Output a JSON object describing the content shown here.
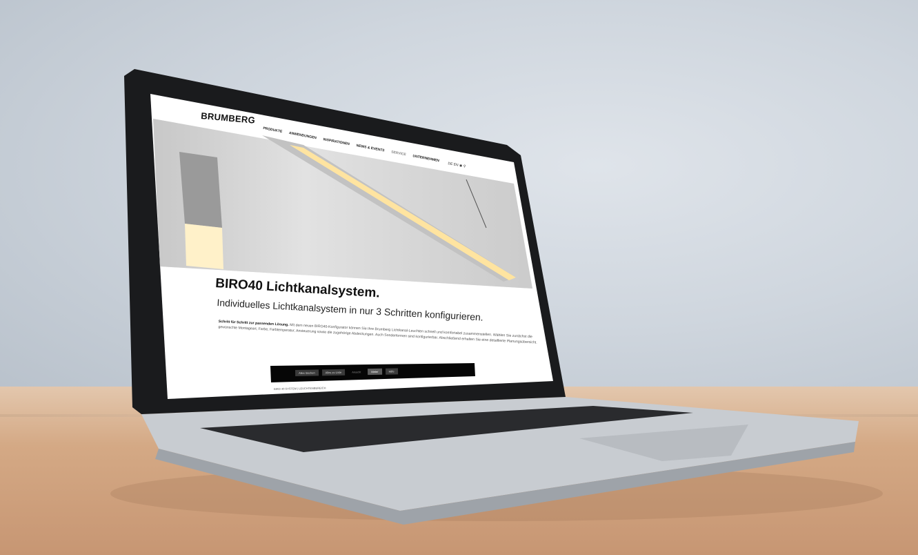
{
  "site": {
    "logo": "BRUMBERG",
    "nav": [
      {
        "label": "PRODUKTE"
      },
      {
        "label": "ANWENDUNGEN"
      },
      {
        "label": "INSPIRATIONEN"
      },
      {
        "label": "NEWS & EVENTS"
      },
      {
        "label": "SERVICE"
      },
      {
        "label": "UNTERNEHMEN"
      }
    ],
    "lang": "DE EN",
    "title": "BIRO40 Lichtkanalsystem.",
    "subtitle": "Individuelles Lichtkanalsystem in nur 3 Schritten konfigurieren.",
    "intro_bold": "Schritt für Schritt zur passenden Lösung.",
    "intro_text": "Mit dem neuen BIRO40-Konfigurator können Sie Ihre Brumberg Lichtkanal-Leuchten schnell und komfortabel zusammenstellen. Wählen Sie zunächst die gewünschte Montageart, Farbe, Farbtemperatur, Ansteuerung sowie die zugehörige Abdeckungen. Auch Sonderformen sind konfigurierbar. Abschließend erhalten Sie eine detaillierte Planungsübersicht.",
    "toolbar": {
      "btn1": "Alles löschen",
      "btn2": "Alles zu Liste",
      "btn3": "Ansicht",
      "btn4": "Meter",
      "btn5": "Hilfe"
    },
    "caption": "BIRO 40 SYSTEM | LEUCHTENBEREICH"
  },
  "colors": {
    "wall": "#cfd6de",
    "desk": "#d4a985",
    "laptop_body": "#c9ccd0",
    "bezel": "#0c0c0d"
  }
}
